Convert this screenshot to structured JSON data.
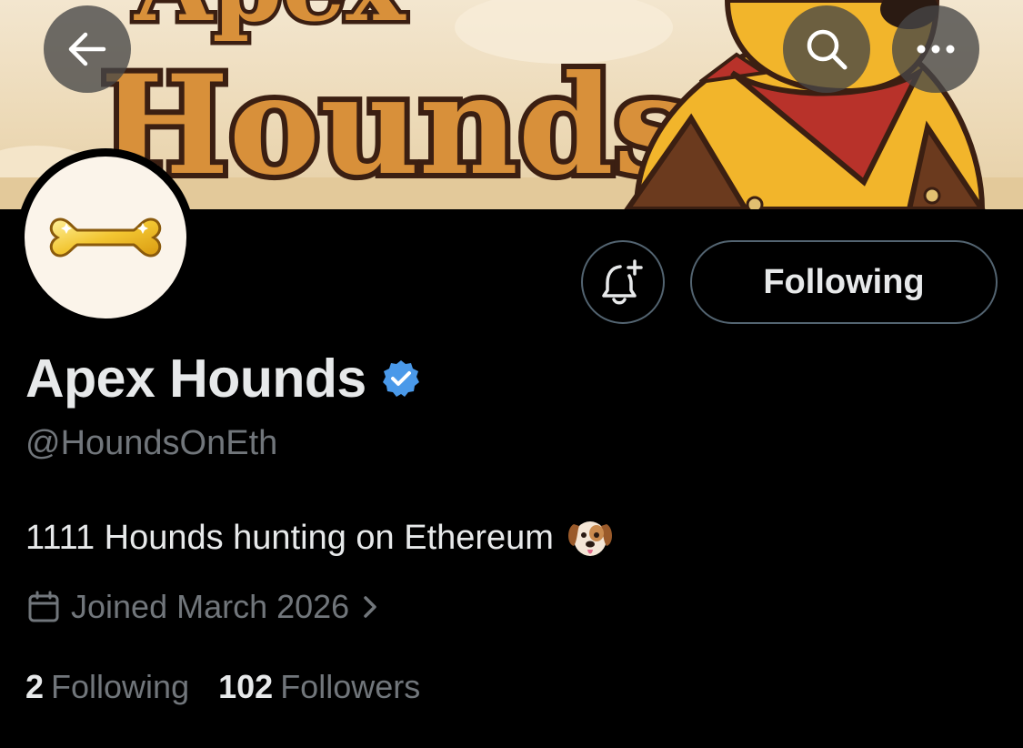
{
  "banner": {
    "text_line1": "Apex",
    "text_line2": "Hounds"
  },
  "nav": {
    "back_icon": "arrow-left-icon",
    "search_icon": "search-icon",
    "more_icon": "more-horizontal-icon"
  },
  "profile": {
    "avatar_icon": "gold-bone-icon",
    "display_name": "Apex Hounds",
    "verified_icon": "verified-badge-icon",
    "verified_color": "#4a99e9",
    "handle": "@HoundsOnEth",
    "bio_text": "1111 Hounds hunting on Ethereum",
    "bio_emoji": "dog-face-emoji",
    "joined_text": "Joined March 2026"
  },
  "actions": {
    "notify_icon": "bell-plus-icon",
    "following_label": "Following"
  },
  "stats": {
    "following_count": "2",
    "following_label": "Following",
    "followers_count": "102",
    "followers_label": "Followers"
  },
  "colors": {
    "background": "#000000",
    "primary_text": "#e7e9ea",
    "secondary_text": "#71767b",
    "border": "#536471"
  }
}
